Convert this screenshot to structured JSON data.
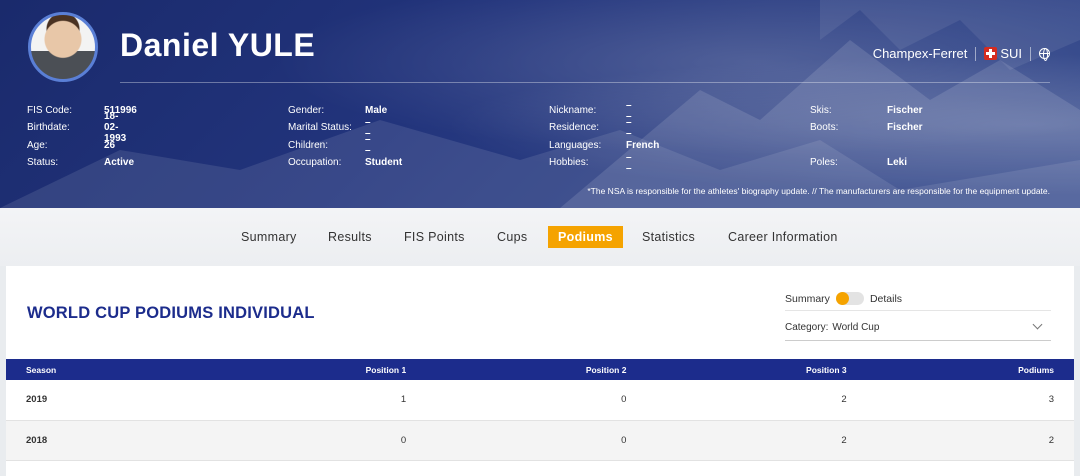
{
  "athlete": {
    "name": "Daniel YULE",
    "location": "Champex-Ferret",
    "nation": "SUI",
    "flag_icon": "swiss-flag-icon",
    "lang_icon": "globe-icon"
  },
  "bio": {
    "col1": [
      {
        "key": "FIS Code:",
        "value": "511996"
      },
      {
        "key": "Birthdate:",
        "value": "18-02-1993"
      },
      {
        "key": "Age:",
        "value": "26"
      },
      {
        "key": "Status:",
        "value": "Active"
      }
    ],
    "col2": [
      {
        "key": "Gender:",
        "value": "Male"
      },
      {
        "key": "Marital Status:",
        "value": "– –"
      },
      {
        "key": "Children:",
        "value": "– –"
      },
      {
        "key": "Occupation:",
        "value": "Student"
      }
    ],
    "col3": [
      {
        "key": "Nickname:",
        "value": "– –"
      },
      {
        "key": "Residence:",
        "value": "– –"
      },
      {
        "key": "Languages:",
        "value": "French"
      },
      {
        "key": "Hobbies:",
        "value": "– –"
      }
    ],
    "col4": [
      {
        "key": "Skis:",
        "value": "Fischer"
      },
      {
        "key": "Boots:",
        "value": "Fischer"
      },
      {
        "key": "",
        "value": ""
      },
      {
        "key": "Poles:",
        "value": "Leki"
      }
    ],
    "disclaimer": "*The NSA is responsible for the athletes' biography update. // The manufacturers are responsible for the equipment update."
  },
  "nav": {
    "tabs": [
      "Summary",
      "Results",
      "FIS Points",
      "Cups",
      "Podiums",
      "Statistics",
      "Career Information"
    ],
    "active": "Podiums"
  },
  "panel": {
    "title": "WORLD CUP PODIUMS INDIVIDUAL",
    "toggle_left": "Summary",
    "toggle_right": "Details",
    "toggle_state": "Summary",
    "category_label": "Category:",
    "category_value": "World Cup",
    "table": {
      "headers": [
        "Season",
        "Position 1",
        "Position 2",
        "Position 3",
        "Podiums"
      ],
      "rows": [
        [
          "2019",
          "1",
          "0",
          "2",
          "3"
        ],
        [
          "2018",
          "0",
          "0",
          "2",
          "2"
        ]
      ]
    }
  },
  "colors": {
    "brand_navy": "#1c2c8c",
    "accent_orange": "#f5a300"
  }
}
